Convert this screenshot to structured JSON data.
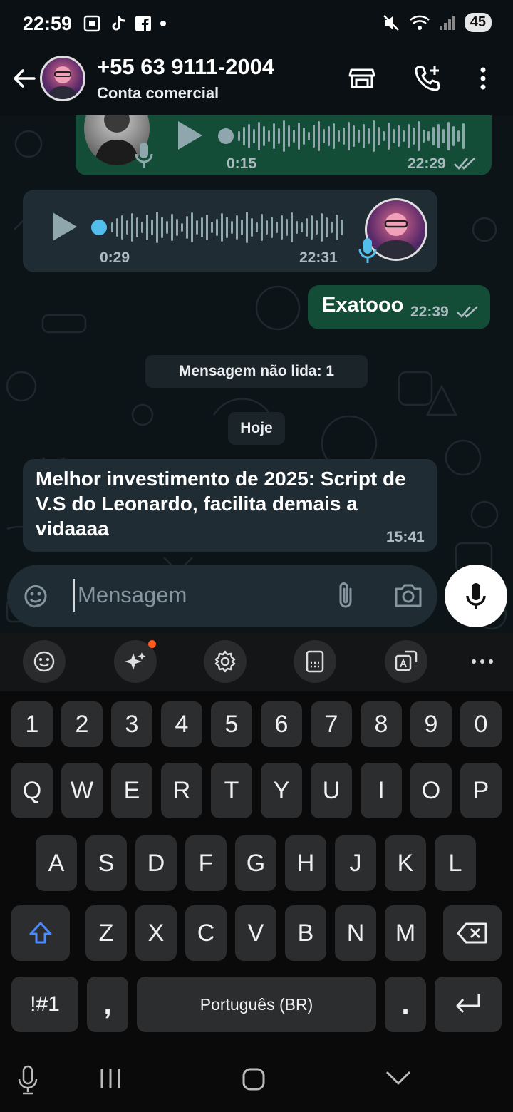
{
  "status_bar": {
    "time": "22:59",
    "battery": "45"
  },
  "header": {
    "contact_name": "+55 63 9111-2004",
    "subtitle": "Conta comercial"
  },
  "messages": [
    {
      "type": "voice",
      "direction": "out",
      "duration": "0:15",
      "time": "22:29",
      "status": "read"
    },
    {
      "type": "voice",
      "direction": "in",
      "duration": "0:29",
      "time": "22:31"
    },
    {
      "type": "text",
      "direction": "out",
      "text": "Exatooo",
      "time": "22:39",
      "status": "read"
    },
    {
      "type": "text",
      "direction": "in",
      "text": "Melhor investimento de 2025: Script de V.S do Leonardo, facilita demais a vidaaaa",
      "time": "15:41"
    }
  ],
  "unread_banner": "Mensagem não lida: 1",
  "date_chip": "Hoje",
  "composer": {
    "placeholder": "Mensagem"
  },
  "keyboard": {
    "number_row": [
      "1",
      "2",
      "3",
      "4",
      "5",
      "6",
      "7",
      "8",
      "9",
      "0"
    ],
    "row1": [
      "Q",
      "W",
      "E",
      "R",
      "T",
      "Y",
      "U",
      "I",
      "O",
      "P"
    ],
    "row2": [
      "A",
      "S",
      "D",
      "F",
      "G",
      "H",
      "J",
      "K",
      "L"
    ],
    "row3": [
      "Z",
      "X",
      "C",
      "V",
      "B",
      "N",
      "M"
    ],
    "symbols_key": "!#1",
    "comma_key": ",",
    "space_label": "Português (BR)",
    "period_key": "."
  },
  "colors": {
    "outgoing_bubble": "#144d37",
    "incoming_bubble": "#1f2c33",
    "accent": "#53bdeb"
  }
}
